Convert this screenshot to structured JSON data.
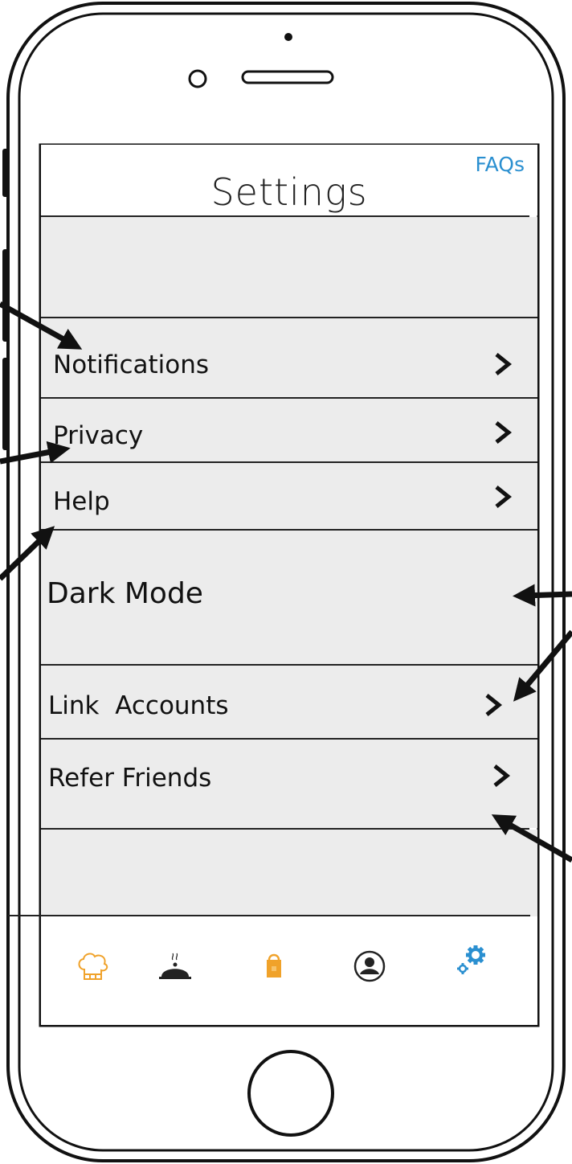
{
  "header": {
    "title": "Settings",
    "faq_label": "FAQs"
  },
  "rows": [
    {
      "label": "Notifications",
      "chevron": true
    },
    {
      "label": "Privacy",
      "chevron": true
    },
    {
      "label": "Help",
      "chevron": true
    },
    {
      "label": "Dark Mode",
      "chevron": false
    },
    {
      "label": "Link  Accounts",
      "chevron": true
    },
    {
      "label": "Refer Friends",
      "chevron": true
    }
  ],
  "tabbar": [
    {
      "icon": "chef-hat-icon",
      "color": "#f0a22a"
    },
    {
      "icon": "serving-cloche-icon",
      "color": "#222222"
    },
    {
      "icon": "shopping-bag-icon",
      "color": "#f0a22a"
    },
    {
      "icon": "profile-icon",
      "color": "#222222"
    },
    {
      "icon": "gear-icon",
      "color": "#2a8fd0",
      "active": true
    }
  ],
  "colors": {
    "accent": "#2a8fd0",
    "row_background": "#ececec",
    "tab_orange": "#f0a22a"
  }
}
